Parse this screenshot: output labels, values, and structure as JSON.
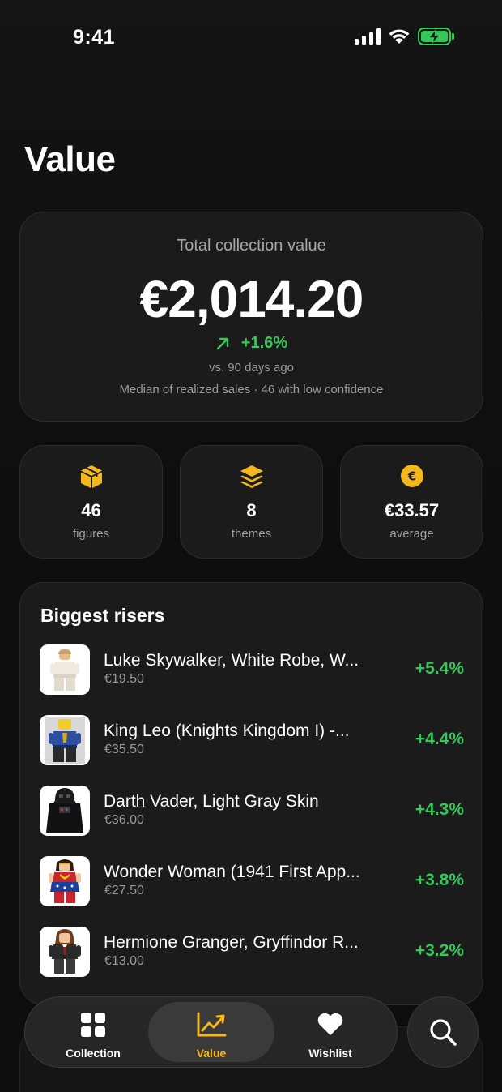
{
  "status_bar": {
    "time": "9:41"
  },
  "page": {
    "title": "Value"
  },
  "summary": {
    "label": "Total collection value",
    "value": "€2,014.20",
    "change": "+1.6%",
    "change_period": "vs. 90 days ago",
    "note": "Median of realized sales · 46 with low confidence"
  },
  "stats": [
    {
      "icon": "cube-icon",
      "value": "46",
      "label": "figures"
    },
    {
      "icon": "layers-icon",
      "value": "8",
      "label": "themes"
    },
    {
      "icon": "euro-coin-icon",
      "value": "€33.57",
      "label": "average"
    }
  ],
  "risers": {
    "title": "Biggest risers",
    "items": [
      {
        "name": "Luke Skywalker, White Robe, W...",
        "price": "€19.50",
        "change": "+5.4%"
      },
      {
        "name": "King Leo (Knights Kingdom I) -...",
        "price": "€35.50",
        "change": "+4.4%"
      },
      {
        "name": "Darth Vader, Light Gray Skin",
        "price": "€36.00",
        "change": "+4.3%"
      },
      {
        "name": "Wonder Woman (1941 First App...",
        "price": "€27.50",
        "change": "+3.8%"
      },
      {
        "name": "Hermione Granger, Gryffindor R...",
        "price": "€13.00",
        "change": "+3.2%"
      }
    ]
  },
  "tabbar": {
    "tabs": [
      {
        "label": "Collection",
        "icon": "grid-icon"
      },
      {
        "label": "Value",
        "icon": "chart-icon",
        "active": true
      },
      {
        "label": "Wishlist",
        "icon": "heart-icon"
      }
    ],
    "search_icon": "search-icon"
  },
  "colors": {
    "accent": "#f5b81c",
    "positive": "#34c759",
    "background": "#0f0f0f",
    "card": "#1b1b1b"
  }
}
